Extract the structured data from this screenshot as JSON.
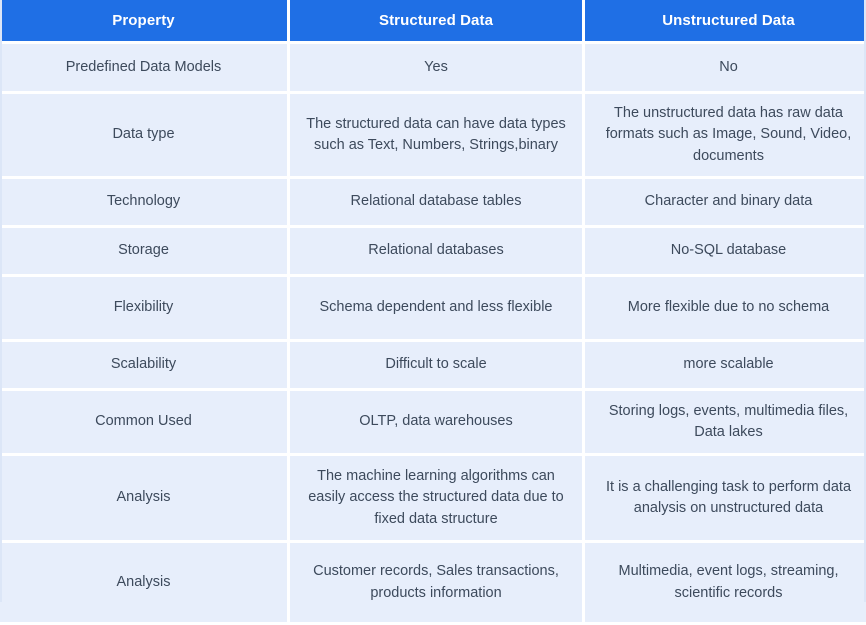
{
  "table": {
    "headers": [
      {
        "label": "Property"
      },
      {
        "label": "Structured Data"
      },
      {
        "label": "Unstructured Data"
      }
    ],
    "rows": [
      {
        "property": "Predefined Data Models",
        "structured": "Yes",
        "unstructured": "No"
      },
      {
        "property": "Data type",
        "structured": "The structured data can have data types such as Text, Numbers, Strings,binary",
        "unstructured": "The unstructured data has raw data formats such as Image, Sound, Video, documents"
      },
      {
        "property": "Technology",
        "structured": "Relational database tables",
        "unstructured": "Character and binary data"
      },
      {
        "property": "Storage",
        "structured": "Relational databases",
        "unstructured": "No-SQL database"
      },
      {
        "property": "Flexibility",
        "structured": "Schema dependent and less flexible",
        "unstructured": "More flexible due to no schema"
      },
      {
        "property": "Scalability",
        "structured": "Difficult to scale",
        "unstructured": "more scalable"
      },
      {
        "property": "Common Used",
        "structured": "OLTP, data warehouses",
        "unstructured": "Storing logs, events, multimedia files, Data lakes"
      },
      {
        "property": "Analysis",
        "structured": "The machine learning algorithms can easily access the structured data due to fixed data structure",
        "unstructured": "It is a challenging task to perform data analysis on unstructured data"
      },
      {
        "property": "Analysis",
        "structured": "Customer records, Sales transactions, products information",
        "unstructured": "Multimedia, event logs, streaming, scientific records"
      }
    ]
  },
  "chart_data": {
    "type": "table",
    "title": "",
    "columns": [
      "Property",
      "Structured Data",
      "Unstructured Data"
    ],
    "rows": [
      [
        "Predefined Data Models",
        "Yes",
        "No"
      ],
      [
        "Data type",
        "The structured data can have data types such as Text, Numbers, Strings,binary",
        "The unstructured data has raw data formats such as Image, Sound, Video, documents"
      ],
      [
        "Technology",
        "Relational database tables",
        "Character and binary data"
      ],
      [
        "Storage",
        "Relational databases",
        "No-SQL database"
      ],
      [
        "Flexibility",
        "Schema dependent and less flexible",
        "More flexible due to no schema"
      ],
      [
        "Scalability",
        "Difficult to scale",
        "more scalable"
      ],
      [
        "Common Used",
        "OLTP, data warehouses",
        "Storing logs, events, multimedia files, Data lakes"
      ],
      [
        "Analysis",
        "The machine learning algorithms can easily access the structured data due to fixed data structure",
        "It is a challenging task to perform data analysis on unstructured data"
      ],
      [
        "Analysis",
        "Customer records, Sales transactions, products information",
        "Multimedia, event logs, streaming, scientific records"
      ]
    ]
  },
  "colors": {
    "header_background": "#1f6fe5",
    "header_text": "#ffffff",
    "cell_background": "#e7eefb",
    "cell_text": "#3d4a5c",
    "gap": "#ffffff",
    "edge_border": "#dce6f7"
  }
}
